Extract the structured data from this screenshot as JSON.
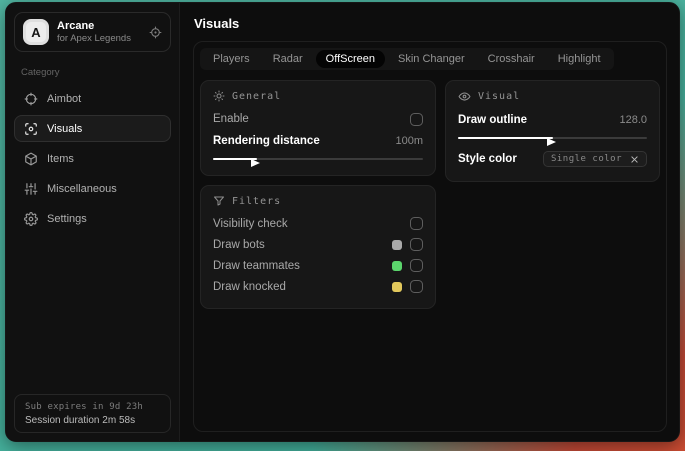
{
  "app": {
    "logo_letter": "A",
    "name": "Arcane",
    "subtitle": "for Apex Legends"
  },
  "sidebar": {
    "category_label": "Category",
    "items": [
      {
        "label": "Aimbot",
        "icon": "crosshair-icon"
      },
      {
        "label": "Visuals",
        "icon": "scan-eye-icon"
      },
      {
        "label": "Items",
        "icon": "package-icon"
      },
      {
        "label": "Miscellaneous",
        "icon": "sliders-icon"
      },
      {
        "label": "Settings",
        "icon": "gear-icon"
      }
    ],
    "active_item": "Visuals",
    "footer": {
      "sub_expires": "Sub expires in 9d 23h",
      "session_duration": "Session duration 2m 58s"
    }
  },
  "header": {
    "title": "Visuals"
  },
  "tabs": {
    "items": [
      {
        "label": "Players"
      },
      {
        "label": "Radar"
      },
      {
        "label": "OffScreen"
      },
      {
        "label": "Skin Changer"
      },
      {
        "label": "Crosshair"
      },
      {
        "label": "Highlight"
      }
    ],
    "active": "OffScreen"
  },
  "panels": {
    "general": {
      "title": "General",
      "enable_label": "Enable",
      "enable_checked": false,
      "rendering_distance_label": "Rendering distance",
      "rendering_distance_value": "100m",
      "rendering_distance_fill_pct": 21
    },
    "visual": {
      "title": "Visual",
      "draw_outline_label": "Draw outline",
      "draw_outline_value": "128.0",
      "draw_outline_fill_pct": 50,
      "style_color_label": "Style color",
      "style_color_value": "Single color"
    },
    "filters": {
      "title": "Filters",
      "rows": [
        {
          "label": "Visibility check",
          "checked": false
        },
        {
          "label": "Draw bots",
          "swatch": "#a9a9a9",
          "checked": false
        },
        {
          "label": "Draw teammates",
          "swatch": "#5bd56c",
          "checked": false
        },
        {
          "label": "Draw knocked",
          "swatch": "#e2c85c",
          "checked": false
        }
      ]
    }
  },
  "colors": {
    "desktop_teal": "#47b19d",
    "desktop_red": "#c8492f",
    "swatch_bots": "#a9a9a9",
    "swatch_teammates": "#5bd56c",
    "swatch_knocked": "#e2c85c"
  }
}
